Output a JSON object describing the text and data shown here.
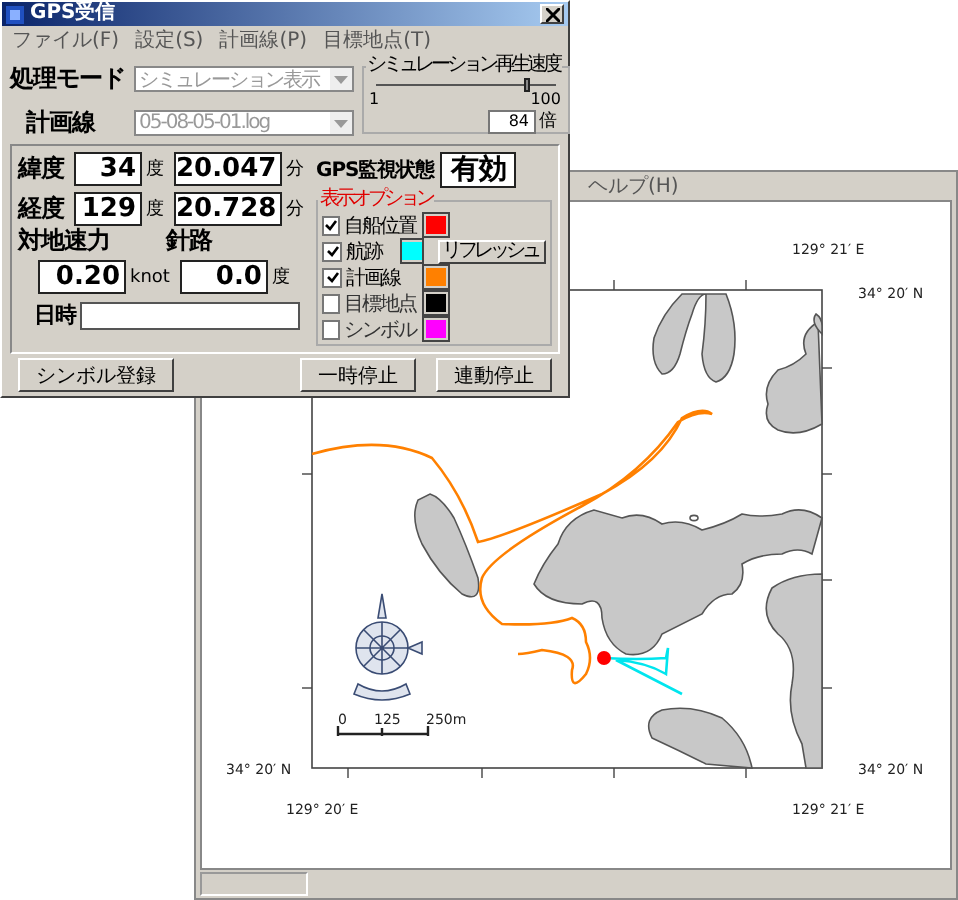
{
  "dialog": {
    "title": "GPS受信",
    "menu": [
      "ファイル(F)",
      "設定(S)",
      "計画線(P)",
      "目標地点(T)"
    ],
    "mode": {
      "label": "処理モード",
      "value": "シミュレーション表示"
    },
    "plan": {
      "label": "計画線",
      "value": "05-08-05-01.log"
    },
    "speed": {
      "title": "シミュレーション再生速度",
      "level": 0.84,
      "min": "1",
      "max": "100",
      "value": "84",
      "unit": "倍"
    },
    "latitude": {
      "label": "緯度",
      "degrees": "34",
      "deg_unit": "度",
      "minutes": "20.047",
      "min_unit": "分"
    },
    "longitude": {
      "label": "経度",
      "degrees": "129",
      "deg_unit": "度",
      "minutes": "20.728",
      "min_unit": "分"
    },
    "ground_speed": {
      "label": "対地速力",
      "value": "0.20",
      "unit": "knot"
    },
    "heading": {
      "label": "針路",
      "value": "0.0",
      "unit": "度"
    },
    "datetime": {
      "label": "日時"
    },
    "gps_status": {
      "label": "GPS監視状態",
      "value": "有効"
    },
    "options": {
      "title": "表示オプション",
      "refresh": "リフレッシュ",
      "items": [
        {
          "label": "自船位置",
          "checked": true,
          "color": "#ff0000"
        },
        {
          "label": "航跡",
          "checked": true,
          "color": "#00ffff"
        },
        {
          "label": "計画線",
          "checked": true,
          "color": "#ff8000"
        },
        {
          "label": "目標地点",
          "checked": false,
          "color": "#000000"
        },
        {
          "label": "シンボル",
          "checked": false,
          "color": "#ff00ff"
        }
      ]
    },
    "buttons": {
      "symbol": "シンボル登録",
      "pause": "一時停止",
      "stop": "連動停止"
    }
  },
  "map_window": {
    "menu": [
      "ヘルプ(H)"
    ],
    "labels": {
      "top_lon": "129° 21′ E",
      "right_top_lat": "34° 20′ N",
      "left_lat": "34° 20′ N",
      "right_lat": "34° 20′ N",
      "bottom_left_lon": "129° 20′ E",
      "bottom_right_lon": "129° 21′ E"
    },
    "scale": [
      "0",
      "125",
      "250m"
    ]
  }
}
